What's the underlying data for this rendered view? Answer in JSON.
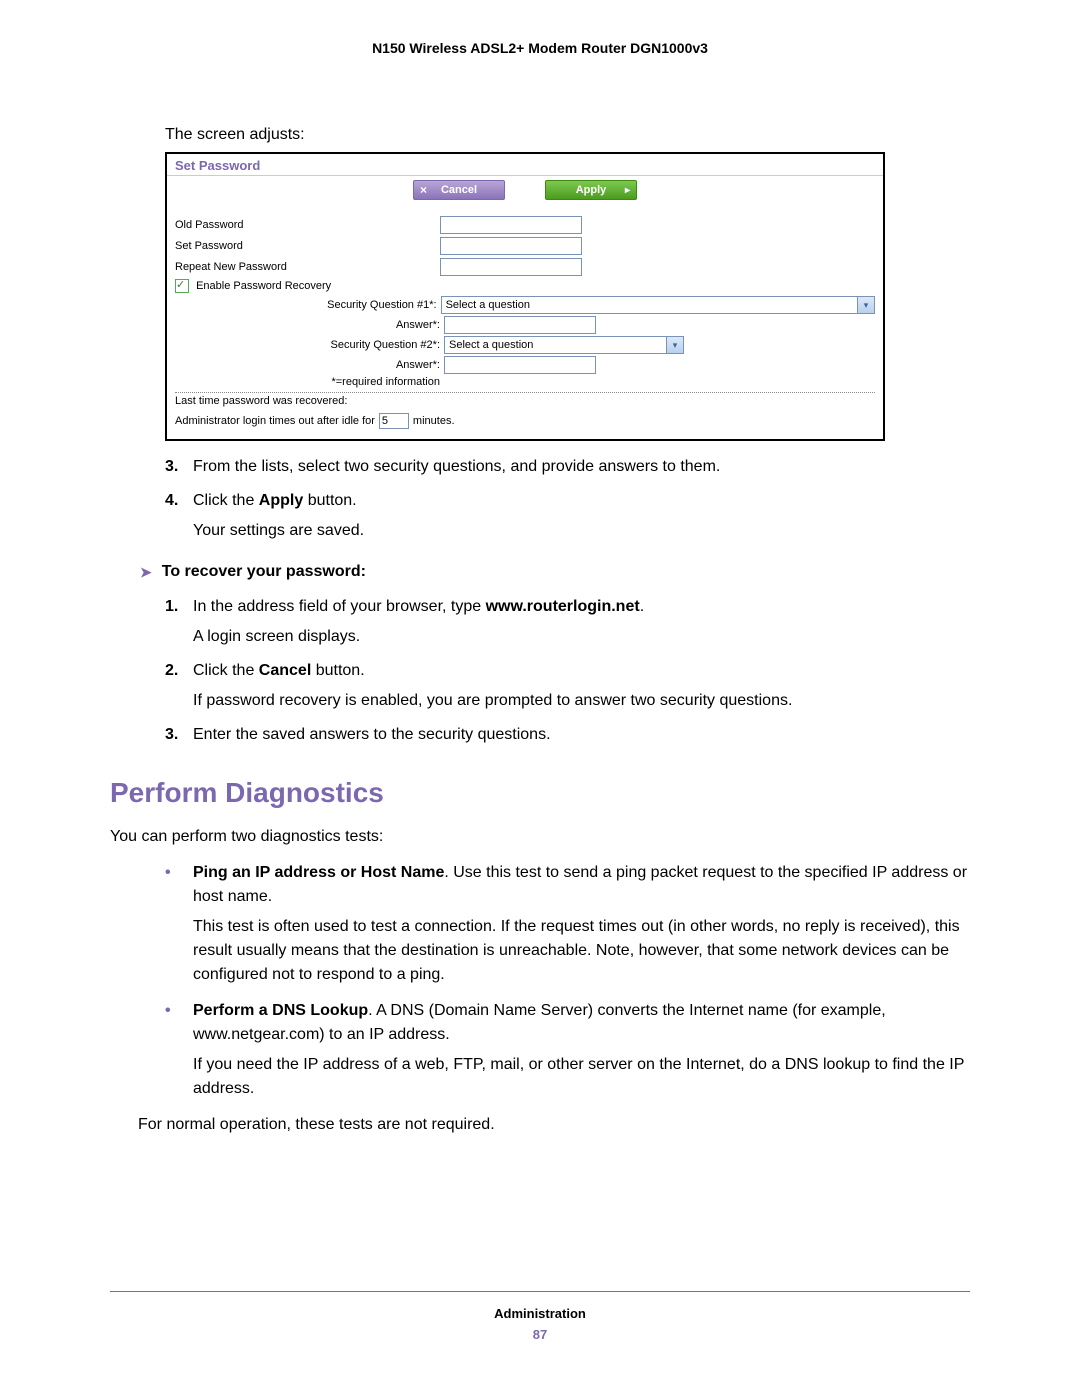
{
  "header": {
    "title": "N150 Wireless ADSL2+ Modem Router DGN1000v3"
  },
  "intro": "The screen adjusts:",
  "screenshot": {
    "title": "Set Password",
    "buttons": {
      "cancel": "Cancel",
      "apply": "Apply"
    },
    "labels": {
      "old_pw": "Old Password",
      "set_pw": "Set Password",
      "repeat_pw": "Repeat New Password",
      "enable_recovery": "Enable Password Recovery",
      "sq1": "Security Question #1*:",
      "sq2": "Security Question #2*:",
      "ans": "Answer*:",
      "required": "*=required information",
      "last_recovered": "Last time password was recovered:",
      "timeout_pre": "Administrator login times out after idle for",
      "timeout_val": "5",
      "timeout_post": "minutes."
    },
    "select_placeholder": "Select a question"
  },
  "steps1": [
    {
      "num": "3.",
      "html": "From the lists, select two security questions, and provide answers to them."
    },
    {
      "num": "4.",
      "html": "Click the <b>Apply</b> button.",
      "sub": "Your settings are saved."
    }
  ],
  "proc_heading": "To recover your password:",
  "steps2": [
    {
      "num": "1.",
      "html": "In the address field of your browser, type <b>www.routerlogin.net</b>.",
      "sub": "A login screen displays."
    },
    {
      "num": "2.",
      "html": "Click the <b>Cancel</b> button.",
      "sub": "If password recovery is enabled, you are prompted to answer two security questions."
    },
    {
      "num": "3.",
      "html": "Enter the saved answers to the security questions."
    }
  ],
  "section_heading": "Perform Diagnostics",
  "section_intro": "You can perform two diagnostics tests:",
  "bullets": [
    {
      "html": "<b>Ping an IP address or Host Name</b>. Use this test to send a ping packet request to the specified IP address or host name.",
      "sub": "This test is often used to test a connection. If the request times out (in other words, no reply is received), this result usually means that the destination is unreachable. Note, however, that some network devices can be configured not to respond to a ping."
    },
    {
      "html": "<b>Perform a DNS Lookup</b>. A DNS (Domain Name Server) converts the Internet name (for example, www.netgear.com) to an IP address.",
      "sub": "If you need the IP address of a web, FTP, mail, or other server on the Internet, do a DNS lookup to find the IP address."
    }
  ],
  "section_outro": "For normal operation, these tests are not required.",
  "footer": {
    "section": "Administration",
    "page": "87"
  }
}
